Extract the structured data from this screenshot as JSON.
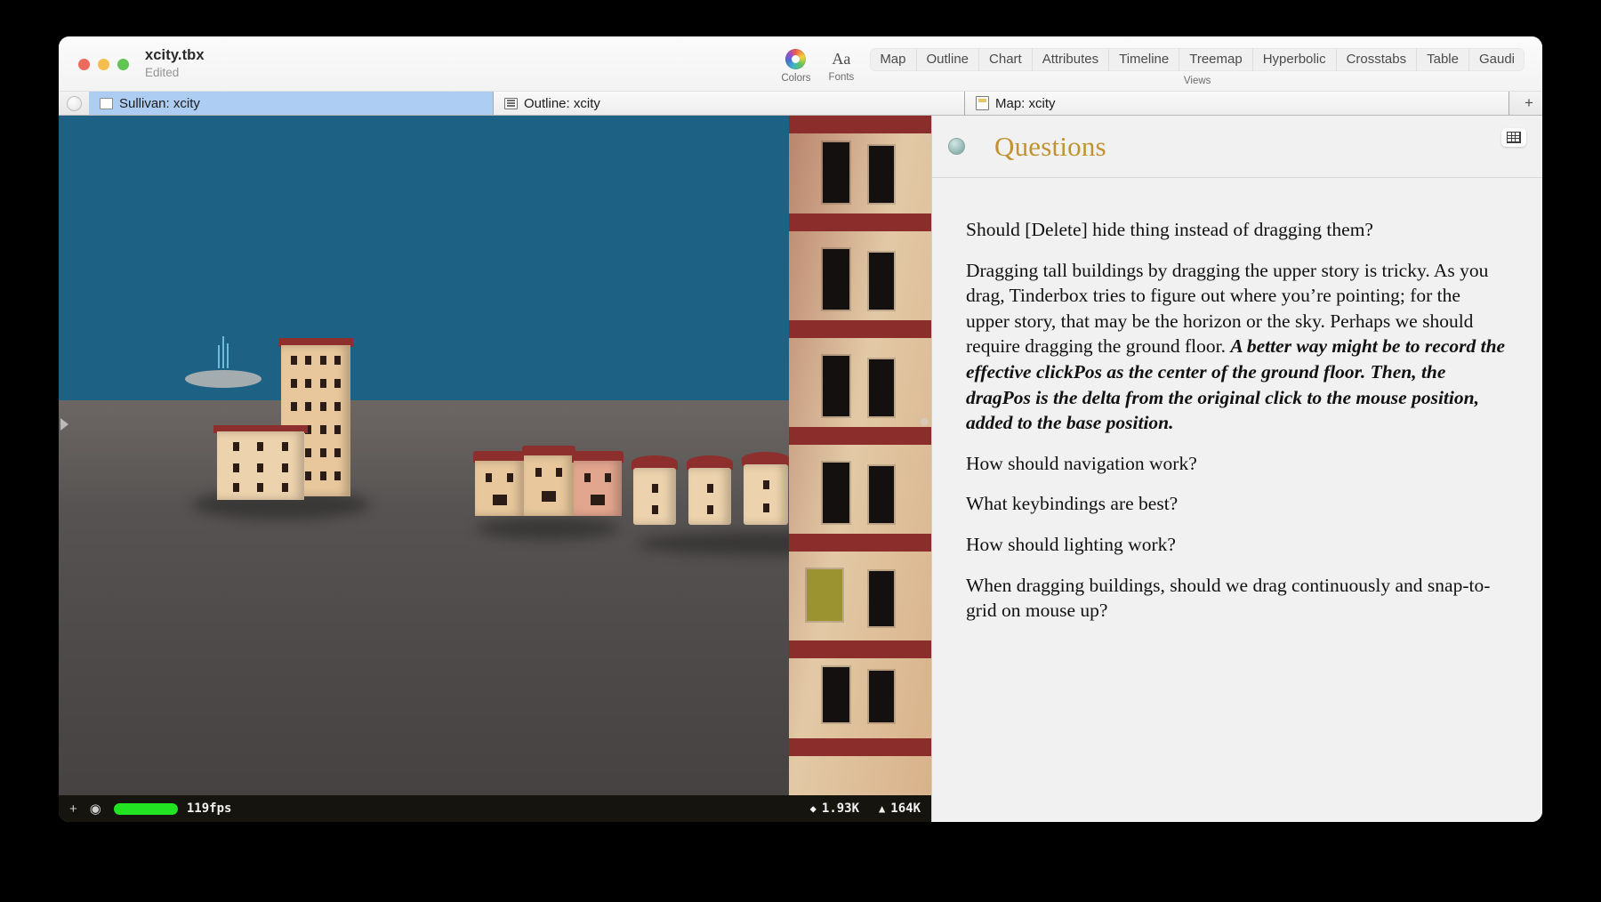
{
  "window": {
    "document_title": "xcity.tbx",
    "document_state": "Edited"
  },
  "toolbar": {
    "colors_label": "Colors",
    "colors_icon": "color-wheel-icon",
    "fonts_label": "Fonts",
    "fonts_icon": "fonts-aa-icon",
    "views_label": "Views",
    "views": [
      "Map",
      "Outline",
      "Chart",
      "Attributes",
      "Timeline",
      "Treemap",
      "Hyperbolic",
      "Crosstabs",
      "Table",
      "Gaudi"
    ]
  },
  "tabstrip": {
    "knob_icon": "tab-knob-icon",
    "add_label": "+",
    "tabs": [
      {
        "label": "Sullivan: xcity",
        "icon": "map-tab-icon",
        "active": true
      },
      {
        "label": "Outline: xcity",
        "icon": "outline-tab-icon",
        "active": false
      },
      {
        "label": "Map: xcity",
        "icon": "map-page-icon",
        "active": false
      }
    ]
  },
  "viewport": {
    "status": {
      "add_icon": "plus-icon",
      "settings_icon": "gear-icon",
      "fps": "119fps",
      "vertices_glyph": "◆",
      "vertices": "1.93K",
      "triangles_glyph": "▲",
      "triangles": "164K"
    },
    "sky_color": "#1d6184",
    "ground_color": "#565352",
    "building_wall_color": "#e8c79c",
    "roof_color": "#8d2f2c"
  },
  "notes": {
    "knob_icon": "note-knob-icon",
    "title": "Questions",
    "title_color": "#c09232",
    "table_button_icon": "table-grid-icon",
    "paragraphs": [
      {
        "runs": [
          {
            "text": "Should [Delete] hide thing instead of dragging them?",
            "bold": false
          }
        ]
      },
      {
        "runs": [
          {
            "text": "Dragging tall buildings by dragging the upper story is tricky. As you drag, Tinderbox tries to figure out where you’re pointing; for the upper story, that may be the horizon or the sky.  Perhaps we should require dragging the ground floor.  ",
            "bold": false
          },
          {
            "text": "A better way might be to record the effective clickPos as the center of the ground floor. Then, the dragPos is the delta from the original click to the mouse position, added to the base position.",
            "bold": true
          }
        ]
      },
      {
        "runs": [
          {
            "text": "How should navigation work?",
            "bold": false
          }
        ]
      },
      {
        "runs": [
          {
            "text": "What keybindings are best?",
            "bold": false
          }
        ]
      },
      {
        "runs": [
          {
            "text": "How should lighting work?",
            "bold": false
          }
        ]
      },
      {
        "runs": [
          {
            "text": "When dragging buildings, should we drag continuously and snap-to-grid on mouse up?",
            "bold": false
          }
        ]
      }
    ]
  }
}
